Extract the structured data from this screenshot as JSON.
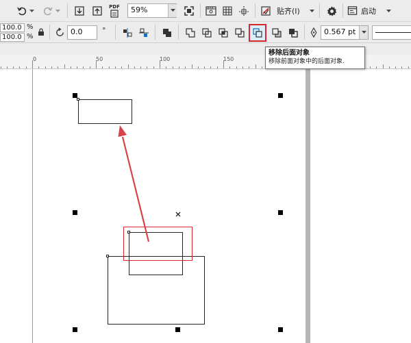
{
  "toolbar_top": {
    "zoom_value": "59%",
    "pdf_label": "PDF",
    "snap_label": "贴齐(I)",
    "launch_label": "启动"
  },
  "property_bar": {
    "scale_x": "100.0",
    "scale_y": "100.0",
    "percent_symbol": "%",
    "rotation_value": "0.0",
    "degree_symbol": "°",
    "outline_width": "0.567 pt"
  },
  "ruler": {
    "labels": [
      "0",
      "50",
      "100",
      "150"
    ]
  },
  "tooltip": {
    "title": "移除后面对象",
    "description": "移除前面对象中的后面对象."
  },
  "colors": {
    "highlight_red": "#d9262c",
    "arrow_red": "#d9434a",
    "toolbar_bg": "#ececec"
  }
}
